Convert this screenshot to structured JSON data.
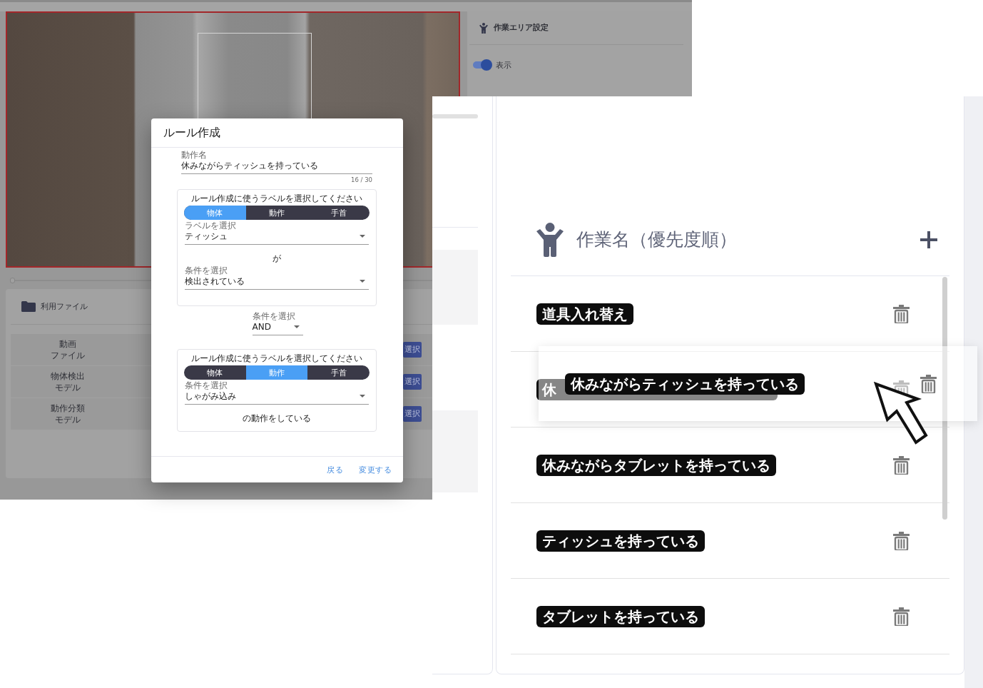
{
  "app": {
    "work_area_panel": {
      "title": "作業エリア設定",
      "display_toggle": {
        "label": "表示",
        "on": true
      }
    },
    "seek_bar": {
      "level": 0
    },
    "files_card": {
      "title": "利用ファイル",
      "rows": [
        {
          "lines": [
            "動画",
            "ファイル"
          ],
          "button": "選択"
        },
        {
          "lines": [
            "物体検出",
            "モデル"
          ],
          "button": "選択"
        },
        {
          "lines": [
            "動作分類",
            "モデル"
          ],
          "button": "選択"
        }
      ]
    },
    "rule_dialog": {
      "title": "ルール作成",
      "name_field": {
        "label": "動作名",
        "value": "休みながらティッシュを持っている",
        "counter": "16 / 30"
      },
      "blocks": [
        {
          "kind": "condition",
          "prompt": "ルール作成に使うラベルを選択してください",
          "segments": [
            {
              "label": "物体",
              "selected": true
            },
            {
              "label": "動作",
              "selected": false
            },
            {
              "label": "手首",
              "selected": false
            }
          ],
          "items": [
            {
              "kind": "select",
              "label": "ラベルを選択",
              "value": "ティッシュ"
            },
            {
              "kind": "text",
              "text": "が"
            },
            {
              "kind": "select",
              "label": "条件を選択",
              "value": "検出されている"
            }
          ]
        },
        {
          "kind": "operator",
          "label": "条件を選択",
          "value": "AND"
        },
        {
          "kind": "condition",
          "prompt": "ルール作成に使うラベルを選択してください",
          "segments": [
            {
              "label": "物体",
              "selected": false
            },
            {
              "label": "動作",
              "selected": true
            },
            {
              "label": "手首",
              "selected": false
            }
          ],
          "items": [
            {
              "kind": "select",
              "label": "条件を選択",
              "value": "しゃがみ込み"
            },
            {
              "kind": "text",
              "text": "の動作をしている"
            }
          ]
        }
      ],
      "buttons": [
        "戻る",
        "変更する"
      ]
    }
  },
  "zoom_panel": {
    "title": "作業名（優先度順）",
    "tasks": [
      {
        "kind": "task",
        "label": "道具入れ替え"
      },
      {
        "kind": "drag_ghost",
        "label": "休"
      },
      {
        "kind": "task",
        "label": "休みながらタブレットを持っている"
      },
      {
        "kind": "task",
        "label": "ティッシュを持っている"
      },
      {
        "kind": "task",
        "label": "タブレットを持っている"
      }
    ],
    "dragged_task": {
      "label": "休みながらティッシュを持っている"
    }
  }
}
